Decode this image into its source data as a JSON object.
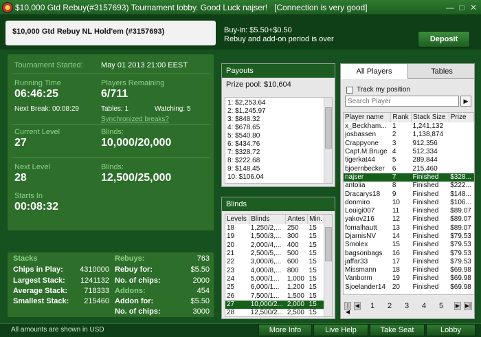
{
  "window": {
    "title": "$10,000 Gtd Rebuy(#3157693) Tournament lobby. Good Luck najser!   [Connection is very good]"
  },
  "header": {
    "tournament_name": "$10,000 Gtd Rebuy NL Hold'em (#3157693)",
    "buyin": "Buy-in: $5.50+$0.50",
    "rebuy_note": "Rebuy and add-on period is over",
    "deposit_label": "Deposit"
  },
  "info": {
    "started_label": "Tournament Started:",
    "started_value": "May 01 2013  21:00 EEST",
    "running_label": "Running Time",
    "running_value": "06:46:25",
    "players_label": "Players Remaining",
    "players_value": "6/711",
    "next_break": "Next Break: 00:08:29",
    "tables": "Tables: 1",
    "watching": "Watching: 5",
    "sync_breaks": "Synchronized breaks?",
    "current_level_label": "Current Level",
    "current_level_value": "27",
    "blinds_label": "Blinds:",
    "current_blinds_value": "10,000/20,000",
    "next_level_label": "Next Level",
    "next_level_value": "28",
    "next_blinds_label": "Blinds:",
    "next_blinds_value": "12,500/25,000",
    "starts_in_label": "Starts In",
    "starts_in_value": "00:08:32"
  },
  "stats": {
    "stacks_label": "Stacks",
    "chips_in_play_label": "Chips in Play:",
    "chips_in_play": "4310000",
    "largest_label": "Largest Stack:",
    "largest": "1241132",
    "average_label": "Average Stack:",
    "average": "718333",
    "smallest_label": "Smallest Stack:",
    "smallest": "215460",
    "rebuys_label": "Rebuys:",
    "rebuys": "763",
    "rebuy_for_label": "Rebuy for:",
    "rebuy_for": "$5.50",
    "no_chips_label": "No. of chips:",
    "no_chips": "2000",
    "addons_label": "Addons:",
    "addons": "454",
    "addon_for_label": "Addon for:",
    "addon_for": "$5.50",
    "no_chips2_label": "No. of chips:",
    "no_chips2": "3000"
  },
  "payouts": {
    "header": "Payouts",
    "prize_pool": "Prize pool: $10,604",
    "rows": [
      "1: $2,253.64",
      "2: $1,245.97",
      "3: $848.32",
      "4: $678.65",
      "5: $540.80",
      "6: $434.76",
      "7: $328.72",
      "8: $222.68",
      "9: $148.45",
      "10: $106.04"
    ]
  },
  "blinds": {
    "header": "Blinds",
    "columns": [
      "Levels",
      "Blinds",
      "Antes",
      "Min."
    ],
    "rows": [
      [
        "18",
        "1,250/2,...",
        "250",
        "15"
      ],
      [
        "19",
        "1,500/3,...",
        "300",
        "15"
      ],
      [
        "20",
        "2,000/4,...",
        "400",
        "15"
      ],
      [
        "21",
        "2,500/5,...",
        "500",
        "15"
      ],
      [
        "22",
        "3,000/6,...",
        "600",
        "15"
      ],
      [
        "23",
        "4,000/8,...",
        "800",
        "15"
      ],
      [
        "24",
        "5,000/1...",
        "1,000",
        "15"
      ],
      [
        "25",
        "6,000/1...",
        "1,200",
        "15"
      ],
      [
        "26",
        "7,500/1...",
        "1,500",
        "15"
      ],
      [
        "27",
        "10,000/2...",
        "2,000",
        "15"
      ],
      [
        "28",
        "12,500/2...",
        "2,500",
        "15"
      ]
    ]
  },
  "players": {
    "tabs": [
      "All Players",
      "Tables"
    ],
    "track_label": "Track my position",
    "search_placeholder": "Search Player",
    "search_button": "▶",
    "columns": [
      "Player name",
      "Rank",
      "Stack Size",
      "Prize"
    ],
    "rows": [
      [
        "x_Beckham...",
        "1",
        "1,241,132",
        ""
      ],
      [
        "josbassen",
        "2",
        "1,138,874",
        ""
      ],
      [
        "Crappyone",
        "3",
        "912,356",
        ""
      ],
      [
        "Capt.M.Bruge",
        "4",
        "512,334",
        ""
      ],
      [
        "tigerkat44",
        "5",
        "289,844",
        ""
      ],
      [
        "bjoernbecker",
        "6",
        "215,460",
        ""
      ],
      [
        "najser",
        "7",
        "Finished",
        "$328..."
      ],
      [
        "antolia",
        "8",
        "Finished",
        "$222..."
      ],
      [
        "Dracarys18",
        "9",
        "Finished",
        "$148..."
      ],
      [
        "donmiro",
        "10",
        "Finished",
        "$106..."
      ],
      [
        "Louigi007",
        "11",
        "Finished",
        "$89.07"
      ],
      [
        "yakov216",
        "12",
        "Finished",
        "$89.07"
      ],
      [
        "fomalhautt",
        "13",
        "Finished",
        "$89.07"
      ],
      [
        "DjarnisNV",
        "14",
        "Finished",
        "$79.53"
      ],
      [
        "Smolex",
        "15",
        "Finished",
        "$79.53"
      ],
      [
        "bagsonbags",
        "16",
        "Finished",
        "$79.53"
      ],
      [
        "jaffar33",
        "17",
        "Finished",
        "$79.53"
      ],
      [
        "Missmann",
        "18",
        "Finished",
        "$69.98"
      ],
      [
        "Vanborm",
        "19",
        "Finished",
        "$69.98"
      ],
      [
        "Sjoelander14",
        "20",
        "Finished",
        "$69.98"
      ]
    ],
    "pages": [
      "1",
      "2",
      "3",
      "4",
      "5"
    ]
  },
  "footer": {
    "note": "All amounts are shown in USD",
    "more_info": "More Info",
    "live_help": "Live Help",
    "take_seat": "Take Seat",
    "lobby": "Lobby"
  }
}
